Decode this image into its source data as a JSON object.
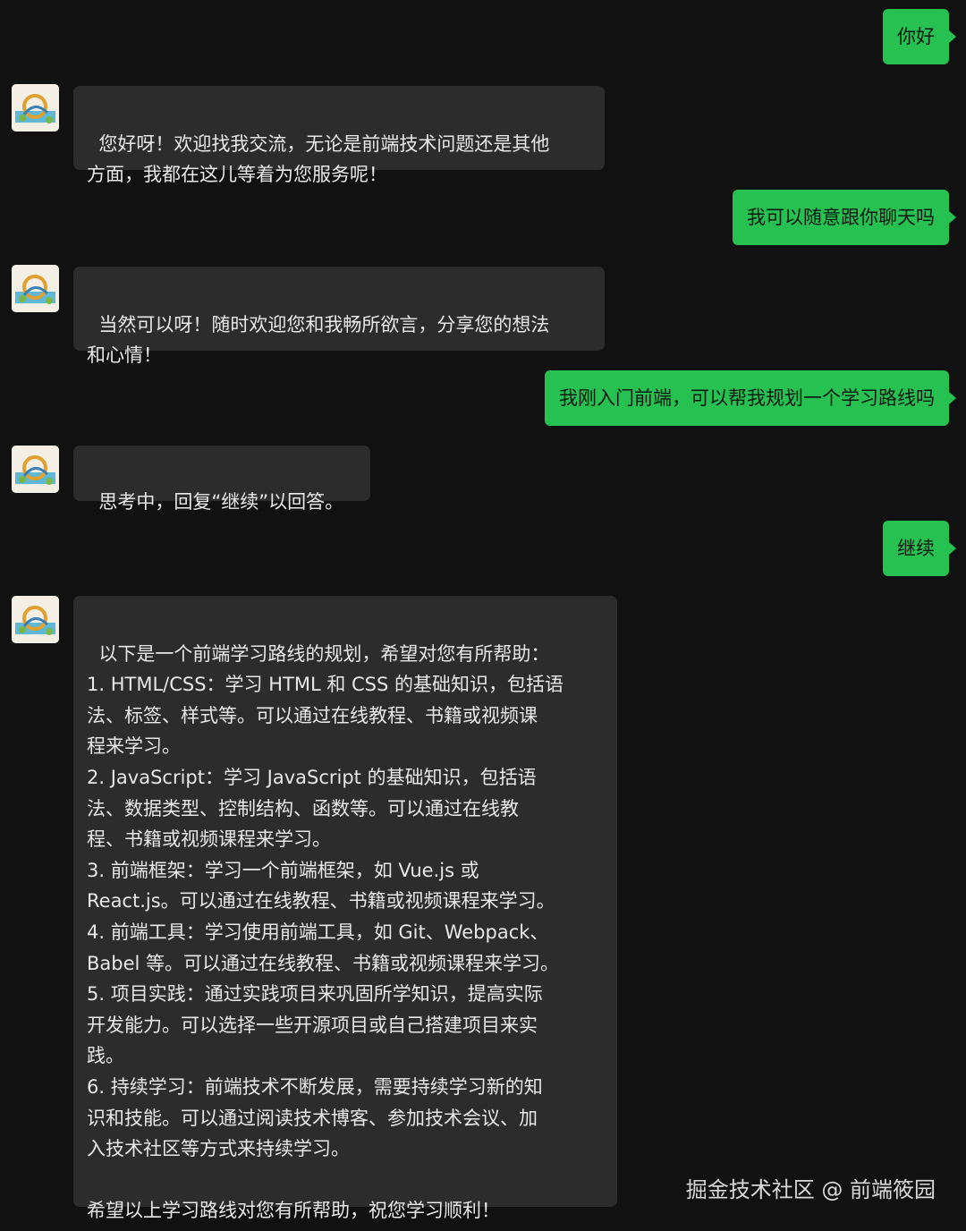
{
  "messages": [
    {
      "from": "me",
      "text": "你好"
    },
    {
      "from": "bot",
      "text": "您好呀！欢迎找我交流，无论是前端技术问题还是其他\n方面，我都在这儿等着为您服务呢！"
    },
    {
      "from": "me",
      "text": "我可以随意跟你聊天吗"
    },
    {
      "from": "bot",
      "text": "当然可以呀！随时欢迎您和我畅所欲言，分享您的想法\n和心情！"
    },
    {
      "from": "me",
      "text": "我刚入门前端，可以帮我规划一个学习路线吗"
    },
    {
      "from": "bot",
      "text": "思考中，回复“继续”以回答。"
    },
    {
      "from": "me",
      "text": "继续"
    },
    {
      "from": "bot",
      "text": "以下是一个前端学习路线的规划，希望对您有所帮助：\n1. HTML/CSS：学习 HTML 和 CSS 的基础知识，包括语\n法、标签、样式等。可以通过在线教程、书籍或视频课\n程来学习。\n2. JavaScript：学习 JavaScript 的基础知识，包括语\n法、数据类型、控制结构、函数等。可以通过在线教\n程、书籍或视频课程来学习。\n3. 前端框架：学习一个前端框架，如 Vue.js 或\nReact.js。可以通过在线教程、书籍或视频课程来学习。\n4. 前端工具：学习使用前端工具，如 Git、Webpack、\nBabel 等。可以通过在线教程、书籍或视频课程来学习。\n5. 项目实践：通过实践项目来巩固所学知识，提高实际\n开发能力。可以选择一些开源项目或自己搭建项目来实\n践。\n6. 持续学习：前端技术不断发展，需要持续学习新的知\n识和技能。可以通过阅读技术博客、参加技术会议、加\n入技术社区等方式来持续学习。\n\n希望以上学习路线对您有所帮助，祝您学习顺利！"
    }
  ],
  "watermark": "掘金技术社区 @ 前端筱园",
  "colors": {
    "background": "#111111",
    "incoming_bubble": "#2c2c2c",
    "outgoing_bubble": "#27c152"
  }
}
